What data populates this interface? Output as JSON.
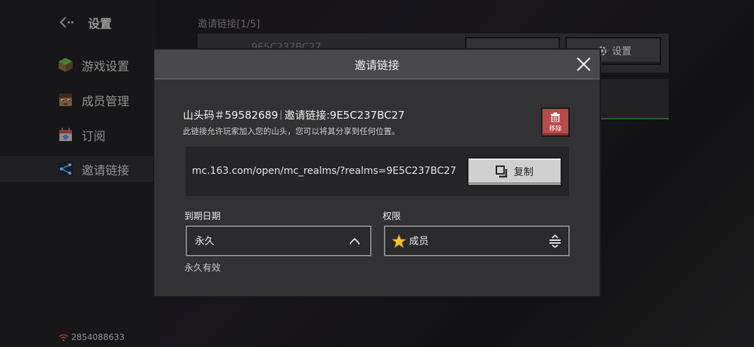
{
  "sidebar": {
    "title": "设置",
    "items": [
      {
        "label": "游戏设置",
        "icon": "grass-block-icon"
      },
      {
        "label": "成员管理",
        "icon": "player-head-icon"
      },
      {
        "label": "订阅",
        "icon": "calendar-icon"
      },
      {
        "label": "邀请链接",
        "icon": "share-icon",
        "active": true
      }
    ],
    "footer_text": "2854088633"
  },
  "background": {
    "section_title": "邀请链接[1/5]",
    "code_partial": "9E5C237BC27",
    "settings_button": "设置"
  },
  "dialog": {
    "title": "邀请链接",
    "server_name": "山头码＃59582689",
    "invite_prefix": "邀请链接:9E5C237BC27",
    "description": "此链接允许玩家加入您的山头，您可以将其分享到任何位置。",
    "remove_label": "移除",
    "link_url": "mc.163.com/open/mc_realms/?realms=9E5C237BC27",
    "copy_label": "复制",
    "expiry": {
      "label": "到期日期",
      "value": "永久",
      "hint": "永久有效"
    },
    "permission": {
      "label": "权限",
      "value": "成员"
    }
  },
  "colors": {
    "dialog_bg": "#323234",
    "header_bg": "#48484b",
    "remove_red": "#b84a4a",
    "copy_button": "#d0d0d0",
    "star_gold": "#f2c230"
  }
}
